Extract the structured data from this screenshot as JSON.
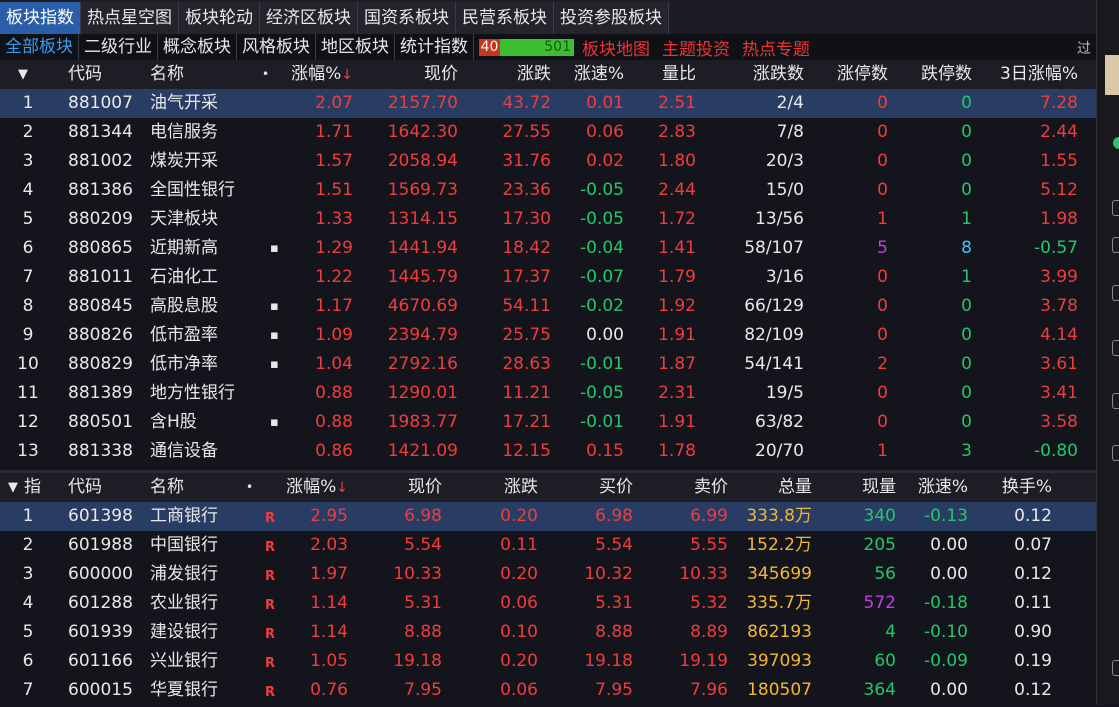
{
  "colors": {
    "accent": "#2b5ea8",
    "up": "#f03c3c",
    "down": "#21c86a",
    "volume": "#f2b735"
  },
  "tabs": [
    {
      "label": "板块指数",
      "active": true
    },
    {
      "label": "热点星空图"
    },
    {
      "label": "板块轮动"
    },
    {
      "label": "经济区板块"
    },
    {
      "label": "国资系板块"
    },
    {
      "label": "民营系板块"
    },
    {
      "label": "投资参股板块"
    }
  ],
  "subtabs": [
    {
      "label": "全部板块",
      "active": true
    },
    {
      "label": "二级行业"
    },
    {
      "label": "概念板块"
    },
    {
      "label": "风格板块"
    },
    {
      "label": "地区板块"
    },
    {
      "label": "统计指数"
    }
  ],
  "breadth": {
    "up": "40",
    "down": "501"
  },
  "links": [
    "板块地图",
    "主题投资",
    "热点专题"
  ],
  "overflow_label": "过",
  "sector_table": {
    "headers": {
      "sort": "▼",
      "code": "代码",
      "name": "名称",
      "dot": "•",
      "pct": "涨幅%",
      "pct_arrow": "↓",
      "price": "现价",
      "chg": "涨跌",
      "speed": "涨速%",
      "vr": "量比",
      "updown": "涨跌数",
      "limitup": "涨停数",
      "limitdown": "跌停数",
      "ret3": "3日涨幅%"
    },
    "rows": [
      {
        "idx": "1",
        "code": "881007",
        "name": "油气开采",
        "mark": "",
        "pct": "2.07",
        "price": "2157.70",
        "chg": "43.72",
        "speed": "0.01",
        "vr": "2.51",
        "updown": "2/4",
        "limitup": "0",
        "limitdown": "0",
        "ret3": "7.28",
        "selected": true
      },
      {
        "idx": "2",
        "code": "881344",
        "name": "电信服务",
        "mark": "",
        "pct": "1.71",
        "price": "1642.30",
        "chg": "27.55",
        "speed": "0.06",
        "vr": "2.83",
        "updown": "7/8",
        "limitup": "0",
        "limitdown": "0",
        "ret3": "2.44"
      },
      {
        "idx": "3",
        "code": "881002",
        "name": "煤炭开采",
        "mark": "",
        "pct": "1.57",
        "price": "2058.94",
        "chg": "31.76",
        "speed": "0.02",
        "vr": "1.80",
        "updown": "20/3",
        "limitup": "0",
        "limitdown": "0",
        "ret3": "1.55"
      },
      {
        "idx": "4",
        "code": "881386",
        "name": "全国性银行",
        "mark": "",
        "pct": "1.51",
        "price": "1569.73",
        "chg": "23.36",
        "speed": "-0.05",
        "vr": "2.44",
        "updown": "15/0",
        "limitup": "0",
        "limitdown": "0",
        "ret3": "5.12"
      },
      {
        "idx": "5",
        "code": "880209",
        "name": "天津板块",
        "mark": "",
        "pct": "1.33",
        "price": "1314.15",
        "chg": "17.30",
        "speed": "-0.05",
        "vr": "1.72",
        "updown": "13/56",
        "limitup": "1",
        "limitdown": "1",
        "ret3": "1.98"
      },
      {
        "idx": "6",
        "code": "880865",
        "name": "近期新高",
        "mark": "▪",
        "pct": "1.29",
        "price": "1441.94",
        "chg": "18.42",
        "speed": "-0.04",
        "vr": "1.41",
        "updown": "58/107",
        "limitup": "5",
        "limitdown": "8",
        "ret3": "-0.57"
      },
      {
        "idx": "7",
        "code": "881011",
        "name": "石油化工",
        "mark": "",
        "pct": "1.22",
        "price": "1445.79",
        "chg": "17.37",
        "speed": "-0.07",
        "vr": "1.79",
        "updown": "3/16",
        "limitup": "0",
        "limitdown": "1",
        "ret3": "3.99"
      },
      {
        "idx": "8",
        "code": "880845",
        "name": "高股息股",
        "mark": "▪",
        "pct": "1.17",
        "price": "4670.69",
        "chg": "54.11",
        "speed": "-0.02",
        "vr": "1.92",
        "updown": "66/129",
        "limitup": "0",
        "limitdown": "0",
        "ret3": "3.78"
      },
      {
        "idx": "9",
        "code": "880826",
        "name": "低市盈率",
        "mark": "▪",
        "pct": "1.09",
        "price": "2394.79",
        "chg": "25.75",
        "speed": "0.00",
        "vr": "1.91",
        "updown": "82/109",
        "limitup": "0",
        "limitdown": "0",
        "ret3": "4.14"
      },
      {
        "idx": "10",
        "code": "880829",
        "name": "低市净率",
        "mark": "▪",
        "pct": "1.04",
        "price": "2792.16",
        "chg": "28.63",
        "speed": "-0.01",
        "vr": "1.87",
        "updown": "54/141",
        "limitup": "2",
        "limitdown": "0",
        "ret3": "3.61"
      },
      {
        "idx": "11",
        "code": "881389",
        "name": "地方性银行",
        "mark": "",
        "pct": "0.88",
        "price": "1290.01",
        "chg": "11.21",
        "speed": "-0.05",
        "vr": "2.31",
        "updown": "19/5",
        "limitup": "0",
        "limitdown": "0",
        "ret3": "3.41"
      },
      {
        "idx": "12",
        "code": "880501",
        "name": "含H股",
        "mark": "▪",
        "pct": "0.88",
        "price": "1983.77",
        "chg": "17.21",
        "speed": "-0.01",
        "vr": "1.91",
        "updown": "63/82",
        "limitup": "0",
        "limitdown": "0",
        "ret3": "3.58"
      },
      {
        "idx": "13",
        "code": "881338",
        "name": "通信设备",
        "mark": "",
        "pct": "0.86",
        "price": "1421.09",
        "chg": "12.15",
        "speed": "0.15",
        "vr": "1.78",
        "updown": "20/70",
        "limitup": "1",
        "limitdown": "3",
        "ret3": "-0.80"
      }
    ]
  },
  "stock_table": {
    "headers": {
      "sort": "▼",
      "idxlabel": "指",
      "code": "代码",
      "name": "名称",
      "dot": "•",
      "pct": "涨幅%",
      "pct_arrow": "↓",
      "price": "现价",
      "chg": "涨跌",
      "bid": "买价",
      "ask": "卖价",
      "vol": "总量",
      "cur": "现量",
      "speed": "涨速%",
      "turnover": "换手%"
    },
    "rows": [
      {
        "idx": "1",
        "code": "601398",
        "name": "工商银行",
        "mark": "R",
        "pct": "2.95",
        "price": "6.98",
        "chg": "0.20",
        "bid": "6.98",
        "ask": "6.99",
        "vol": "333.8万",
        "cur": "340",
        "speed": "-0.13",
        "turnover": "0.12",
        "selected": true
      },
      {
        "idx": "2",
        "code": "601988",
        "name": "中国银行",
        "mark": "R",
        "pct": "2.03",
        "price": "5.54",
        "chg": "0.11",
        "bid": "5.54",
        "ask": "5.55",
        "vol": "152.2万",
        "cur": "205",
        "speed": "0.00",
        "turnover": "0.07"
      },
      {
        "idx": "3",
        "code": "600000",
        "name": "浦发银行",
        "mark": "R",
        "pct": "1.97",
        "price": "10.33",
        "chg": "0.20",
        "bid": "10.32",
        "ask": "10.33",
        "vol": "345699",
        "cur": "56",
        "speed": "0.00",
        "turnover": "0.12"
      },
      {
        "idx": "4",
        "code": "601288",
        "name": "农业银行",
        "mark": "R",
        "pct": "1.14",
        "price": "5.31",
        "chg": "0.06",
        "bid": "5.31",
        "ask": "5.32",
        "vol": "335.7万",
        "cur": "572",
        "speed": "-0.18",
        "turnover": "0.11"
      },
      {
        "idx": "5",
        "code": "601939",
        "name": "建设银行",
        "mark": "R",
        "pct": "1.14",
        "price": "8.88",
        "chg": "0.10",
        "bid": "8.88",
        "ask": "8.89",
        "vol": "862193",
        "cur": "4",
        "speed": "-0.10",
        "turnover": "0.90"
      },
      {
        "idx": "6",
        "code": "601166",
        "name": "兴业银行",
        "mark": "R",
        "pct": "1.05",
        "price": "19.18",
        "chg": "0.20",
        "bid": "19.18",
        "ask": "19.19",
        "vol": "397093",
        "cur": "60",
        "speed": "-0.09",
        "turnover": "0.19"
      },
      {
        "idx": "7",
        "code": "600015",
        "name": "华夏银行",
        "mark": "R",
        "pct": "0.76",
        "price": "7.95",
        "chg": "0.06",
        "bid": "7.95",
        "ask": "7.96",
        "vol": "180507",
        "cur": "364",
        "speed": "0.00",
        "turnover": "0.12"
      }
    ]
  }
}
